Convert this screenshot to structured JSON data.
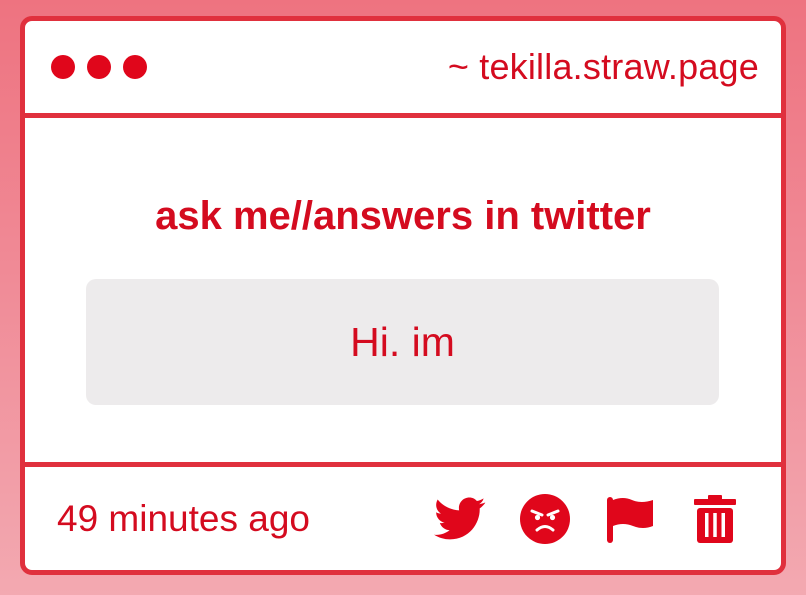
{
  "window": {
    "url": "~ tekilla.straw.page",
    "controls": [
      "close",
      "minimize",
      "maximize"
    ]
  },
  "main": {
    "title": "ask me//answers in twitter",
    "message": "Hi. im"
  },
  "footer": {
    "timestamp": "49 minutes ago",
    "actions": [
      {
        "name": "twitter",
        "icon": "twitter-icon"
      },
      {
        "name": "angry",
        "icon": "angry-face-icon"
      },
      {
        "name": "report",
        "icon": "flag-icon"
      },
      {
        "name": "delete",
        "icon": "trash-icon"
      }
    ]
  },
  "colors": {
    "accent": "#e0061b",
    "text": "#d40b1f",
    "border": "#e0303d",
    "message_bg": "#edebec"
  }
}
